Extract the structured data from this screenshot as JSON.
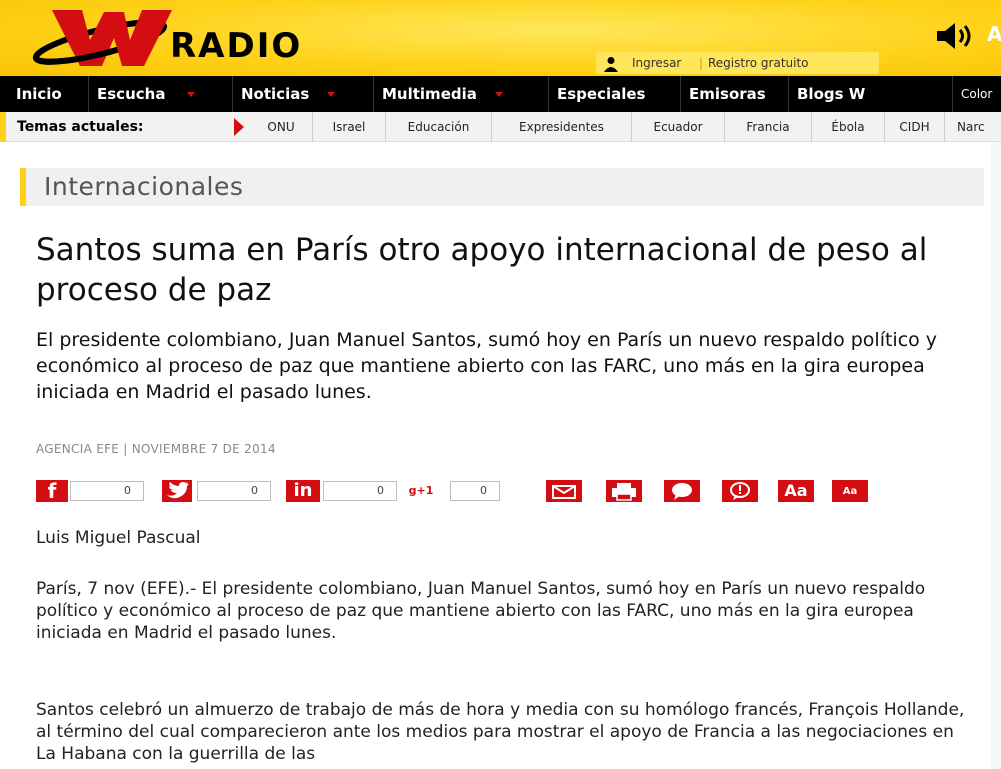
{
  "header": {
    "logo_text": "RADIO",
    "login": "Ingresar",
    "register": "Registro gratuito",
    "login_separator": "|",
    "live_label": "A"
  },
  "nav": {
    "items": [
      {
        "label": "Inicio"
      },
      {
        "label": "Escucha"
      },
      {
        "label": "Noticias"
      },
      {
        "label": "Multimedia"
      },
      {
        "label": "Especiales"
      },
      {
        "label": "Emisoras"
      },
      {
        "label": "Blogs W"
      },
      {
        "label": "Color"
      }
    ]
  },
  "topics": {
    "label": "Temas actuales:",
    "items": [
      "ONU",
      "Israel",
      "Educación",
      "Expresidentes",
      "Ecuador",
      "Francia",
      "Ébola",
      "CIDH",
      "Narc"
    ]
  },
  "section": {
    "title": "Internacionales"
  },
  "article": {
    "headline": "Santos suma en París otro apoyo internacional de peso al proceso de paz",
    "lead": "El presidente colombiano, Juan Manuel Santos, sumó hoy en París un nuevo respaldo político y económico al proceso de paz que mantiene abierto con las FARC, uno más en la gira europea iniciada en Madrid el pasado lunes.",
    "byline": "AGENCIA EFE | NOVIEMBRE 7 DE 2014",
    "author": "Luis Miguel Pascual",
    "paragraph1": "París, 7 nov (EFE).- El presidente colombiano, Juan Manuel Santos, sumó hoy en París un nuevo respaldo político y económico al proceso de paz que mantiene abierto con las FARC, uno más en la gira europea iniciada en Madrid el pasado lunes.",
    "paragraph2": "Santos celebró un almuerzo de trabajo de más de hora y media con su homólogo francés, François Hollande, al término del cual comparecieron ante los medios para mostrar el apoyo de Francia a las negociaciones en La Habana con la guerrilla de las"
  },
  "share": {
    "facebook_count": "0",
    "twitter_count": "0",
    "linkedin_count": "0",
    "gplus_count": "0",
    "gplus_label": "g+1",
    "font_large": "Aa",
    "font_small": "Aa"
  },
  "colors": {
    "brand_yellow": "#ffd21a",
    "accent_red": "#d40d12",
    "nav_black": "#000000"
  }
}
